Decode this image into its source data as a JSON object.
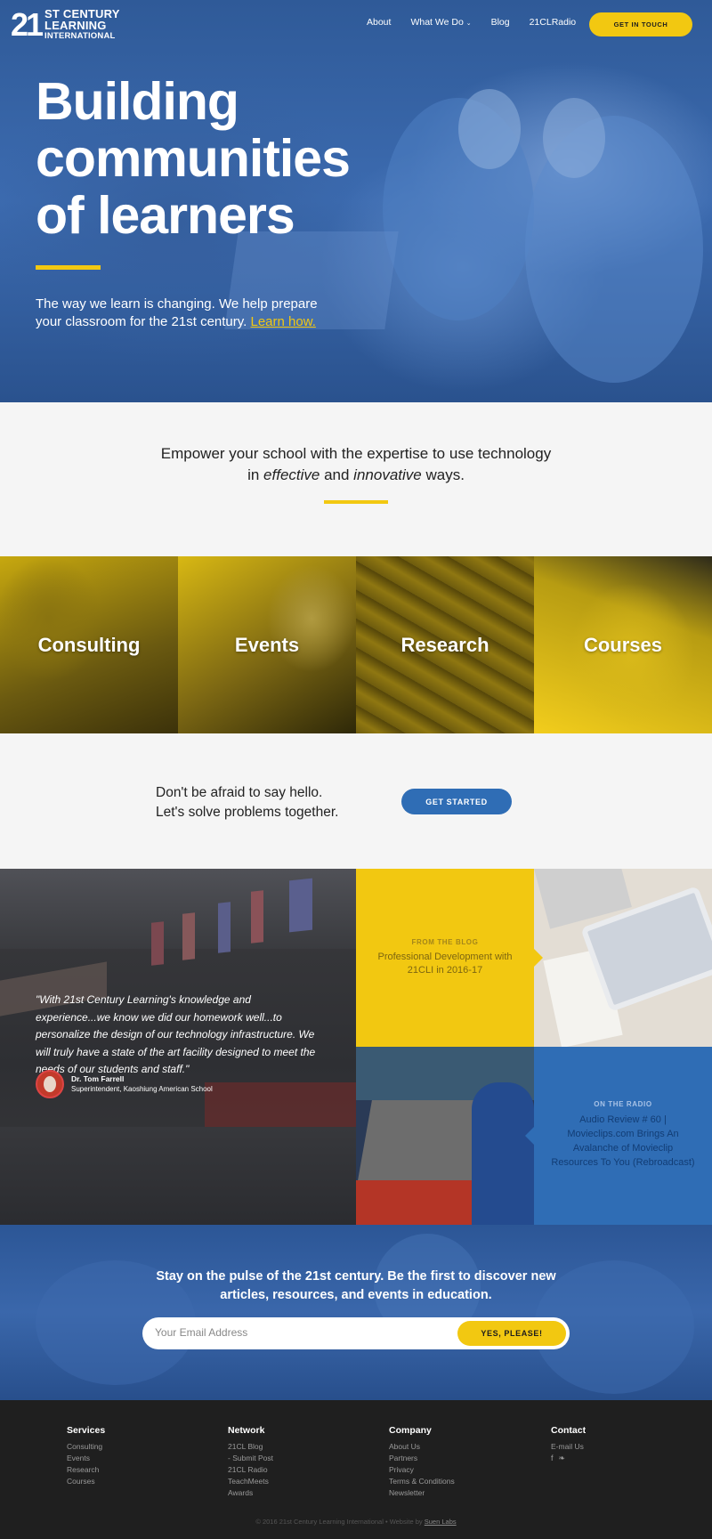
{
  "brand": {
    "mark": "21",
    "line1": "ST CENTURY",
    "line2": "LEARNING",
    "line3": "INTERNATIONAL"
  },
  "nav": {
    "items": [
      {
        "label": "About"
      },
      {
        "label": "What We Do"
      },
      {
        "label": "Blog"
      },
      {
        "label": "21CLRadio"
      }
    ],
    "cta": "GET IN TOUCH"
  },
  "hero": {
    "title": "Building communities of learners",
    "subtitle": "The way we learn is changing. We help prepare your classroom for the 21st century.",
    "link": "Learn how."
  },
  "empower": {
    "line1": "Empower your school with the expertise to use technology",
    "pre": "in ",
    "em1": "effective",
    "mid": " and ",
    "em2": "innovative",
    "post": " ways."
  },
  "tiles": [
    {
      "label": "Consulting"
    },
    {
      "label": "Events"
    },
    {
      "label": "Research"
    },
    {
      "label": "Courses"
    }
  ],
  "hello": {
    "line1": "Don't be afraid to say hello.",
    "line2": "Let's solve problems together.",
    "button": "GET STARTED"
  },
  "testimonial": {
    "quote": "\"With 21st Century Learning's knowledge and experience...we know we did our homework well...to personalize the design of our technology infrastructure. We will truly have a state of the art facility designed to meet the needs of our students and staff.\"",
    "name": "Dr. Tom Farrell",
    "role": "Superintendent, Kaoshiung American School"
  },
  "blog": {
    "kicker": "FROM THE BLOG",
    "title": "Professional Development with 21CLI in 2016-17"
  },
  "radio": {
    "kicker": "ON THE RADIO",
    "title": "Audio Review # 60 | Movieclips.com Brings An Avalanche of Movieclip Resources To You (Rebroadcast)"
  },
  "newsletter": {
    "heading": "Stay on the pulse of the 21st century. Be the first to discover new articles, resources, and events in education.",
    "placeholder": "Your Email Address",
    "button": "YES, PLEASE!"
  },
  "footer": {
    "columns": [
      {
        "title": "Services",
        "items": [
          "Consulting",
          "Events",
          "Research",
          "Courses"
        ]
      },
      {
        "title": "Network",
        "items": [
          "21CL Blog",
          "- Submit Post",
          "21CL Radio",
          "TeachMeets",
          "Awards"
        ]
      },
      {
        "title": "Company",
        "items": [
          "About Us",
          "Partners",
          "Privacy",
          "Terms & Conditions",
          "Newsletter"
        ]
      },
      {
        "title": "Contact",
        "items": [
          "E-mail Us"
        ]
      }
    ],
    "social": [
      "facebook-icon",
      "twitter-icon"
    ],
    "copyright": "© 2016 21st Century Learning International • Website by",
    "credit": "Suen Labs"
  },
  "colors": {
    "accent_yellow": "#f2c811",
    "accent_blue": "#2f6db5",
    "footer_bg": "#1f1f1f"
  }
}
